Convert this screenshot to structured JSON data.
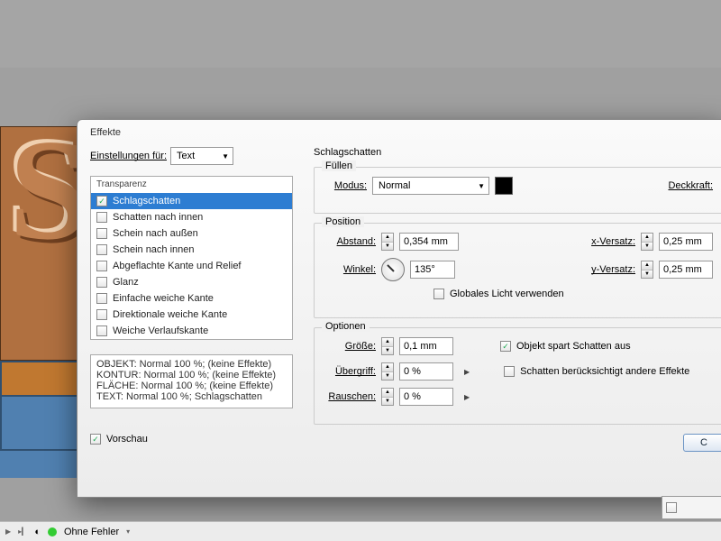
{
  "dialog": {
    "title": "Effekte",
    "settings_for_label": "Einstellungen für:",
    "settings_for_value": "Text",
    "effects_header": "Transparenz",
    "effects": [
      {
        "label": "Schlagschatten",
        "checked": true,
        "selected": true
      },
      {
        "label": "Schatten nach innen",
        "checked": false,
        "selected": false
      },
      {
        "label": "Schein nach außen",
        "checked": false,
        "selected": false
      },
      {
        "label": "Schein nach innen",
        "checked": false,
        "selected": false
      },
      {
        "label": "Abgeflachte Kante und Relief",
        "checked": false,
        "selected": false
      },
      {
        "label": "Glanz",
        "checked": false,
        "selected": false
      },
      {
        "label": "Einfache weiche Kante",
        "checked": false,
        "selected": false
      },
      {
        "label": "Direktionale weiche Kante",
        "checked": false,
        "selected": false
      },
      {
        "label": "Weiche Verlaufskante",
        "checked": false,
        "selected": false
      }
    ],
    "summary": [
      "OBJEKT: Normal 100 %; (keine Effekte)",
      "KONTUR: Normal 100 %; (keine Effekte)",
      "FLÄCHE: Normal 100 %; (keine Effekte)",
      "TEXT: Normal 100 %; Schlagschatten"
    ],
    "preview_label": "Vorschau",
    "preview_checked": true
  },
  "panel": {
    "title": "Schlagschatten",
    "fill": {
      "legend": "Füllen",
      "mode_label": "Modus:",
      "mode_value": "Normal",
      "opacity_label": "Deckkraft:"
    },
    "position": {
      "legend": "Position",
      "distance_label": "Abstand:",
      "distance_value": "0,354 mm",
      "angle_label": "Winkel:",
      "angle_value": "135°",
      "xoffset_label": "x-Versatz:",
      "xoffset_value": "0,25 mm",
      "yoffset_label": "y-Versatz:",
      "yoffset_value": "0,25 mm",
      "global_light_label": "Globales Licht verwenden",
      "global_light_checked": false
    },
    "options": {
      "legend": "Optionen",
      "size_label": "Größe:",
      "size_value": "0,1 mm",
      "overhang_label": "Übergriff:",
      "overhang_value": "0 %",
      "noise_label": "Rauschen:",
      "noise_value": "0 %",
      "spares_label": "Objekt spart Schatten aus",
      "spares_checked": true,
      "considers_label": "Schatten berücksichtigt andere Effekte",
      "considers_checked": false
    },
    "ok_visible_char": "C"
  },
  "canvas_fragment": "S",
  "status": {
    "text": "Ohne Fehler"
  }
}
